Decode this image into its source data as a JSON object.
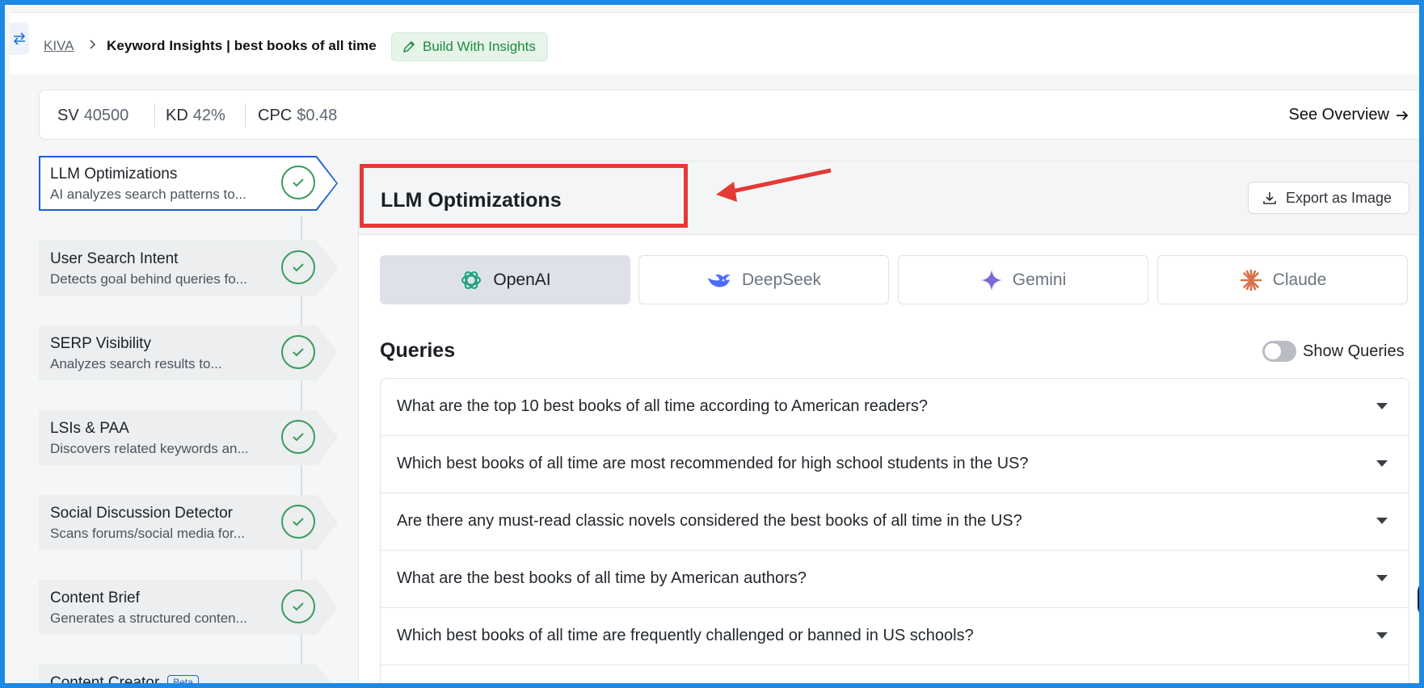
{
  "breadcrumb": {
    "root": "KIVA",
    "title": "Keyword Insights | best books of all time",
    "build_label": "Build With Insights"
  },
  "metrics": {
    "sv_label": "SV",
    "sv_value": "40500",
    "kd_label": "KD",
    "kd_value": "42%",
    "cpc_label": "CPC",
    "cpc_value": "$0.48",
    "overview_label": "See Overview"
  },
  "sidebar": {
    "items": [
      {
        "title": "LLM Optimizations",
        "desc": "AI analyzes search patterns to..."
      },
      {
        "title": "User Search Intent",
        "desc": "Detects goal behind queries fo..."
      },
      {
        "title": "SERP Visibility",
        "desc": "Analyzes search results to..."
      },
      {
        "title": "LSIs & PAA",
        "desc": "Discovers related keywords an..."
      },
      {
        "title": "Social Discussion Detector",
        "desc": "Scans forums/social media for..."
      },
      {
        "title": "Content Brief",
        "desc": "Generates a structured conten..."
      },
      {
        "title": "Content Creator",
        "desc": "",
        "badge": "Beta"
      }
    ]
  },
  "main": {
    "title": "LLM Optimizations",
    "export_label": "Export as Image",
    "tabs": [
      {
        "label": "OpenAI",
        "icon": "openai-icon"
      },
      {
        "label": "DeepSeek",
        "icon": "deepseek-icon"
      },
      {
        "label": "Gemini",
        "icon": "gemini-icon"
      },
      {
        "label": "Claude",
        "icon": "claude-icon"
      }
    ],
    "queries_title": "Queries",
    "show_queries_label": "Show Queries",
    "queries": [
      "What are the top 10 best books of all time according to American readers?",
      "Which best books of all time are most recommended for high school students in the US?",
      "Are there any must-read classic novels considered the best books of all time in the US?",
      "What are the best books of all time by American authors?",
      "Which best books of all time are frequently challenged or banned in US schools?"
    ]
  },
  "colors": {
    "frame": "#1e88e5",
    "accent_blue": "#1d5fd6",
    "success_green": "#3a9b5c",
    "annotation_red": "#e53935"
  }
}
